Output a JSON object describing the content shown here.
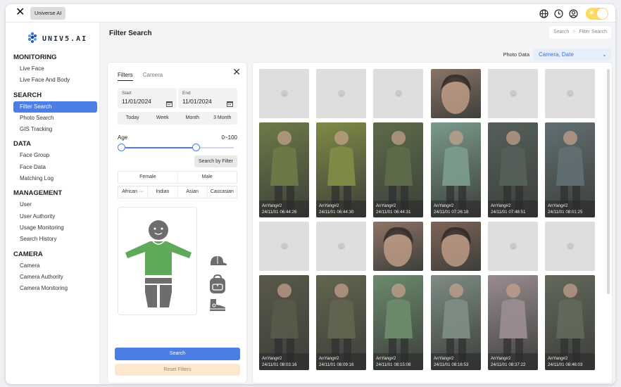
{
  "titlebar": {
    "close_glyph": "✕",
    "app_name": "Universe AI",
    "icons": [
      "globe-icon",
      "clock-icon",
      "user-icon",
      "theme-toggle"
    ],
    "theme_color": "#ffd95c"
  },
  "sidebar": {
    "logo_text": "UNIV5.AI",
    "sections": [
      {
        "title": "MONITORING",
        "items": [
          "Live Face",
          "Live Face And Body"
        ]
      },
      {
        "title": "SEARCH",
        "items": [
          "Filter Search",
          "Photo Search",
          "GIS Tracking"
        ]
      },
      {
        "title": "DATA",
        "items": [
          "Face Group",
          "Face Data",
          "Matching Log"
        ]
      },
      {
        "title": "MANAGEMENT",
        "items": [
          "User",
          "User Authority",
          "Usage Monitoring",
          "Search History"
        ]
      },
      {
        "title": "CAMERA",
        "items": [
          "Camera",
          "Camera Authority",
          "Camera Monitoring"
        ]
      }
    ],
    "active_item": "Filter Search",
    "accent_color": "#4d7ee6"
  },
  "header": {
    "title": "Filter Search",
    "breadcrumb": [
      "Search",
      "Filter Search"
    ],
    "photo_data_label": "Photo Data",
    "photo_data_value": "Camera, Date"
  },
  "filter": {
    "tabs": [
      "Filters",
      "Camera"
    ],
    "start_label": "Start",
    "start_value": "11/01/2024",
    "end_label": "End",
    "end_value": "11/01/2024",
    "quick_ranges": [
      "Today",
      "Week",
      "Month",
      "3 Month"
    ],
    "age_label": "Age",
    "age_range": "0~100",
    "age_min": 0,
    "age_max_fraction": 0.66,
    "search_by_filter": "Search by Filter",
    "genders": [
      "Female",
      "Male"
    ],
    "ethnicities": [
      "African ···",
      "Indian",
      "Asian",
      "Caucasian"
    ],
    "accessories": [
      "cap-icon",
      "backpack-icon",
      "shoe-icon"
    ],
    "top_color": "#5faa5a",
    "search_button": "Search",
    "reset_button": "Reset Filters"
  },
  "results": {
    "rows": [
      {
        "kind": "face",
        "tiles": [
          {
            "placeholder": true
          },
          {
            "placeholder": true
          },
          {
            "placeholder": true
          },
          {
            "placeholder": false,
            "bg": "#8b7468"
          },
          {
            "placeholder": true
          },
          {
            "placeholder": true
          }
        ]
      },
      {
        "kind": "body",
        "tiles": [
          {
            "camera": "AnYang#2",
            "time": "24/11/01 06:44:26",
            "bg": "#6d7a47"
          },
          {
            "camera": "AnYang#2",
            "time": "24/11/01 06:44:30",
            "bg": "#7f8b46"
          },
          {
            "camera": "AnYang#2",
            "time": "24/11/01 06:44:31",
            "bg": "#5d6b4a"
          },
          {
            "camera": "AnYang#2",
            "time": "24/11/01 07:26:18",
            "bg": "#7b9a8c"
          },
          {
            "camera": "AnYang#2",
            "time": "24/11/01 07:48:51",
            "bg": "#55605a"
          },
          {
            "camera": "AnYang#2",
            "time": "24/11/01 08:01:25",
            "bg": "#616f72"
          }
        ]
      },
      {
        "kind": "face",
        "tiles": [
          {
            "placeholder": true
          },
          {
            "placeholder": true
          },
          {
            "placeholder": false,
            "bg": "#8f7466"
          },
          {
            "placeholder": false,
            "bg": "#7f6357"
          },
          {
            "placeholder": true
          },
          {
            "placeholder": true
          }
        ]
      },
      {
        "kind": "body",
        "tiles": [
          {
            "camera": "AnYang#2",
            "time": "24/11/01 08:03:16",
            "bg": "#59584a"
          },
          {
            "camera": "AnYang#2",
            "time": "24/11/01 08:09:16",
            "bg": "#63644f"
          },
          {
            "camera": "AnYang#2",
            "time": "24/11/01 08:15:08",
            "bg": "#6b8a6c"
          },
          {
            "camera": "AnYang#2",
            "time": "24/11/01 08:16:53",
            "bg": "#7d8c84"
          },
          {
            "camera": "AnYang#2",
            "time": "24/11/01 08:37:22",
            "bg": "#9a8c90"
          },
          {
            "camera": "AnYang#2",
            "time": "24/11/01 08:46:03",
            "bg": "#62685a"
          }
        ]
      }
    ]
  }
}
